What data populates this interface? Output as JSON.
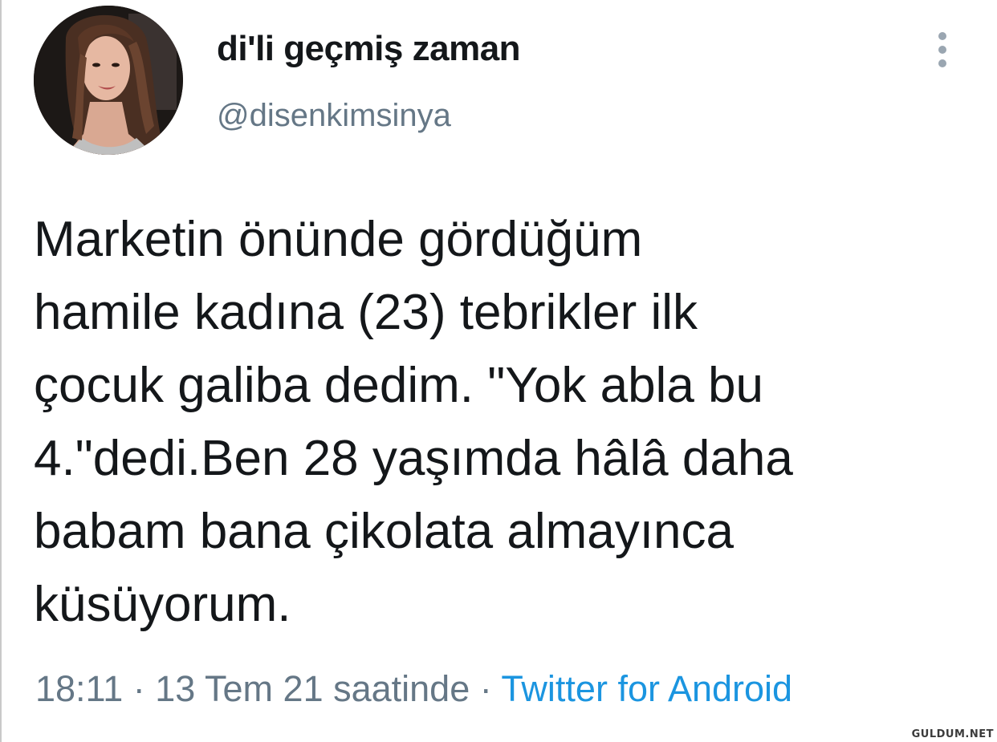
{
  "tweet": {
    "author": {
      "display_name": "di'li geçmiş zaman",
      "handle": "@disenkimsinya"
    },
    "text_lines": [
      "Marketin önünde gördüğüm",
      "hamile kadına (23) tebrikler ilk",
      "çocuk galiba dedim. \"Yok abla bu",
      "4.\"dedi.Ben 28 yaşımda hâlâ daha",
      "babam bana çikolata almayınca",
      "küsüyorum."
    ],
    "time": "18:11",
    "date": "13 Tem 21 saatinde",
    "separator": " · ",
    "source": "Twitter for Android"
  },
  "watermark": "GULDUM.NET",
  "icons": {
    "avatar": "avatar-photo",
    "more": "more-vertical-icon"
  },
  "colors": {
    "text": "#14171a",
    "secondary": "#657786",
    "link": "#1b95e0"
  }
}
